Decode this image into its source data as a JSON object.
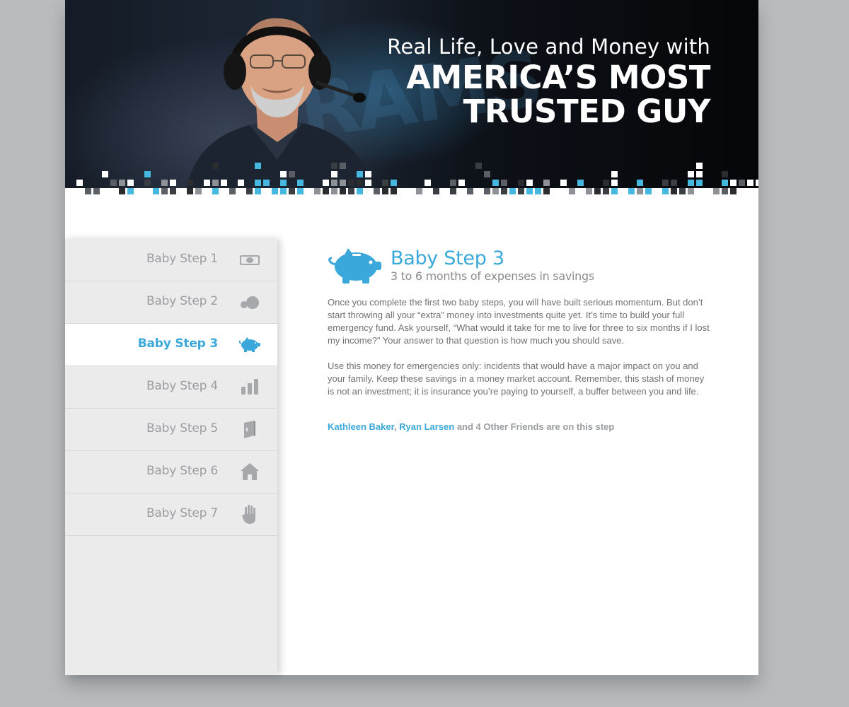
{
  "hero": {
    "tagline_small": "Real Life, Love and Money with",
    "tagline_big_line1": "AMERICA’S MOST",
    "tagline_big_line2": "TRUSTED GUY",
    "accent_color": "#46b7df"
  },
  "sidebar": {
    "items": [
      {
        "label": "Baby Step 1",
        "icon": "money-bill-icon",
        "active": false
      },
      {
        "label": "Baby Step 2",
        "icon": "snowball-icon",
        "active": false
      },
      {
        "label": "Baby Step 3",
        "icon": "piggy-bank-icon",
        "active": true
      },
      {
        "label": "Baby Step 4",
        "icon": "bar-chart-icon",
        "active": false
      },
      {
        "label": "Baby Step 5",
        "icon": "book-icon",
        "active": false
      },
      {
        "label": "Baby Step 6",
        "icon": "house-icon",
        "active": false
      },
      {
        "label": "Baby Step 7",
        "icon": "hand-icon",
        "active": false
      }
    ]
  },
  "main": {
    "icon": "piggy-bank-icon",
    "title": "Baby Step 3",
    "subtitle": "3 to 6 months of expenses in savings",
    "paragraph1": "Once you complete the first two baby steps, you will have built serious momentum. But don’t start throwing all your “extra” money into investments quite yet. It’s time to build your full emergency fund. Ask yourself, “What would it take for me to live for three to six months if I lost my income?” Your answer to that question is how much you should save.",
    "paragraph2": "Use this money for emergencies only: incidents that would have a major impact on you and your family. Keep these savings in a money market account. Remember, this stash of money is not an investment; it is insurance you’re paying to yourself, a buffer between you and life.",
    "friends": {
      "friend1": "Kathleen Baker",
      "separator": ", ",
      "friend2": "Ryan Larsen",
      "suffix": " and 4 Other Friends are on this step"
    }
  },
  "colors": {
    "accent": "#3aa8db",
    "sidebar_bg": "#ebebec",
    "body_text": "#6f7175",
    "page_bg": "#b9bcbf"
  }
}
